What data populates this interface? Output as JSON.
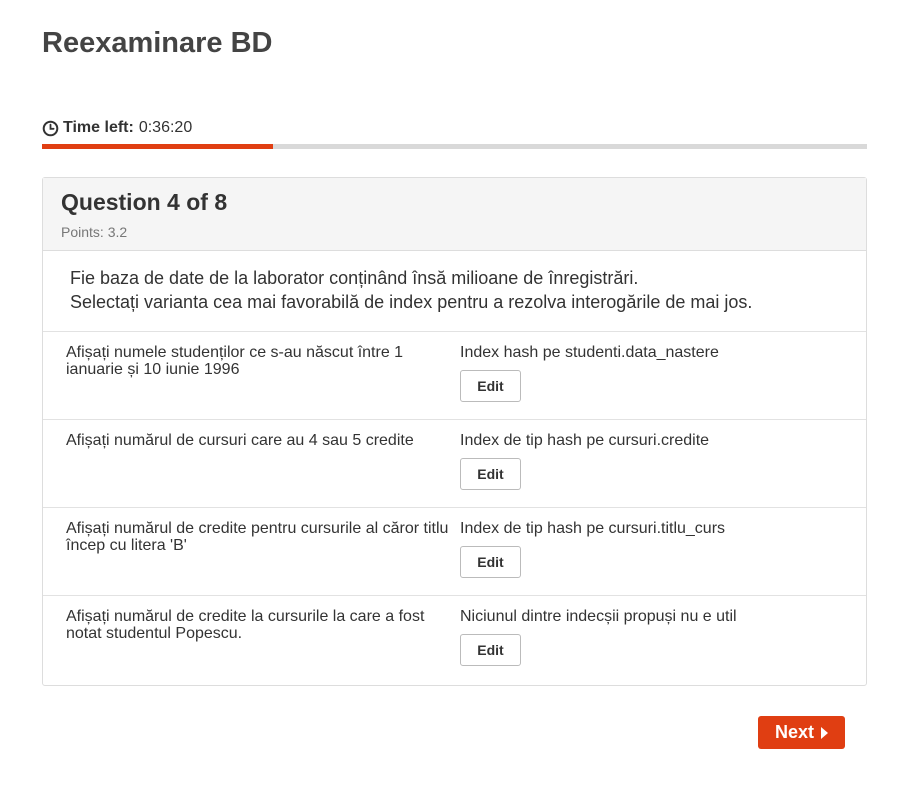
{
  "page": {
    "title": "Reexaminare BD"
  },
  "timer": {
    "icon": "clock-icon",
    "label": "Time left:",
    "value": "0:36:20",
    "progress_fraction": 0.28
  },
  "question": {
    "title": "Question 4 of 8",
    "points": "Points: 3.2",
    "prompt_lines": [
      "Fie baza de date de la laborator conținând însă milioane de înregistrări.",
      "Selectați varianta cea mai favorabilă de index pentru a rezolva interogările de mai jos."
    ],
    "rows": [
      {
        "statement": "Afișați numele studenților ce s-au născut între 1 ianuarie și 10 iunie 1996",
        "answer": "Index hash pe studenti.data_nastere",
        "edit_label": "Edit"
      },
      {
        "statement": "Afișați numărul de cursuri care au 4 sau 5 credite",
        "answer": "Index de tip hash pe cursuri.credite",
        "edit_label": "Edit"
      },
      {
        "statement": "Afișați numărul de credite pentru cursurile al căror titlu încep cu litera 'B'",
        "answer": "Index de tip hash pe cursuri.titlu_curs",
        "edit_label": "Edit"
      },
      {
        "statement": "Afișați numărul de credite la cursurile la care a fost notat studentul Popescu.",
        "answer": "Niciunul dintre indecșii propuși nu e util",
        "edit_label": "Edit"
      }
    ]
  },
  "navigation": {
    "next_label": "Next",
    "next_icon": "caret-right-icon"
  },
  "colors": {
    "accent": "#e03e12",
    "track": "#d9d9d9",
    "header_bg": "#f5f5f5"
  }
}
